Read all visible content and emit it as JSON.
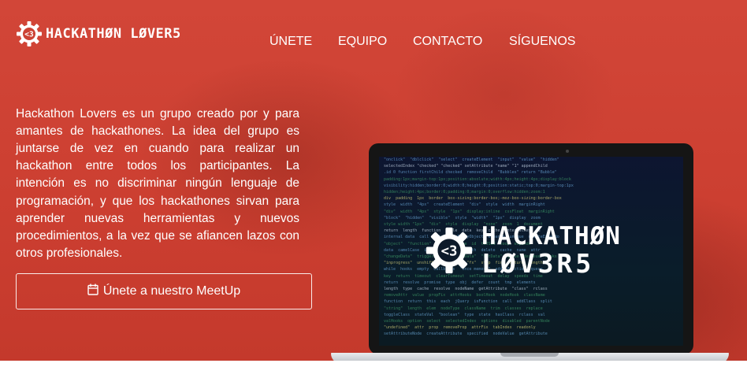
{
  "brand": {
    "logo_symbol": "<3",
    "name": "HACKATHØN LØVER5"
  },
  "nav": {
    "items": [
      "ÚNETE",
      "EQUIPO",
      "CONTACTO",
      "SÍGUENOS"
    ]
  },
  "hero": {
    "description": "Hackathon Lovers es un grupo creado por y para amantes de hackathones. La idea del grupo es juntarse de vez en cuando para realizar un hackathon entre todos los participantes. La intención es no discriminar ningún lenguaje de programación, y que los hackathones sirvan para aprender nuevas herramientas y nuevos procedimientos, a la vez que se afiancen lazos con otros profesionales.",
    "cta_label": "Únete a nuestro MeetUp",
    "cta_icon": "calendar-icon"
  },
  "screen": {
    "logo_symbol": "<3",
    "title_line1": "HACKATHØN",
    "title_line2": "LØV3R5"
  },
  "colors": {
    "hero_red": "#cc4234",
    "text": "#ffffff"
  }
}
